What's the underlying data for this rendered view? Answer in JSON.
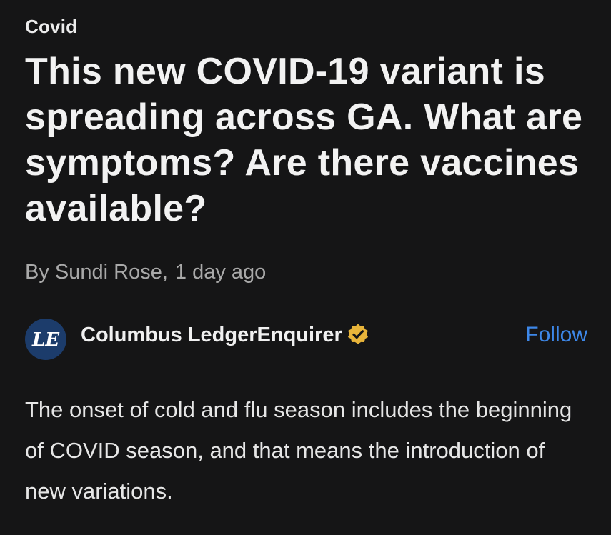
{
  "article": {
    "category": "Covid",
    "headline": "This new COVID-19 variant is spreading across GA. What are symptoms? Are there vaccines available?",
    "byline": {
      "author": "By Sundi Rose,",
      "time": "1 day ago"
    },
    "publisher": {
      "logo_text": "LE",
      "name": "Columbus LedgerEnquirer",
      "verified_icon": "verified-badge-icon",
      "follow_label": "Follow"
    },
    "body": "The onset of cold and flu season includes the beginning of COVID season, and that means the introduction of new variations."
  },
  "colors": {
    "background": "#151516",
    "text": "#ececec",
    "muted": "#a9a9a9",
    "accent": "#3d87e8",
    "logo_bg": "#1c3c6b",
    "badge": "#e8b43a"
  }
}
